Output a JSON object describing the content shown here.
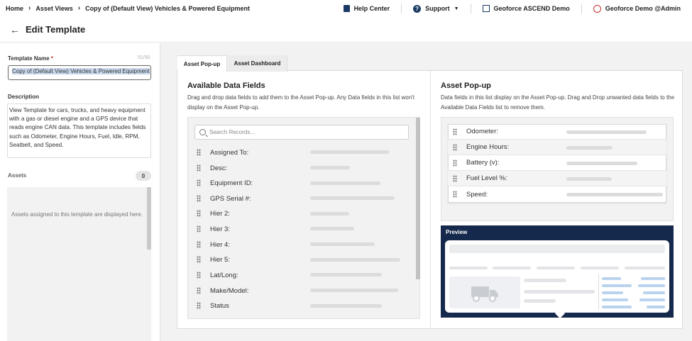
{
  "breadcrumb": [
    "Home",
    "Asset Views",
    "Copy of (Default View) Vehicles & Powered Equipment"
  ],
  "topnav": {
    "help": "Help Center",
    "support": "Support",
    "org": "Geoforce ASCEND Demo",
    "user": "Geoforce Demo @Admin"
  },
  "page": {
    "title": "Edit Template"
  },
  "form": {
    "name_label": "Template Name",
    "required_mark": "*",
    "name_counter": "51/90",
    "name_value": "Copy of (Default View) Vehicles & Powered Equipment",
    "description_label": "Description",
    "description_value": "View Template for cars, trucks, and heavy equipment with a gas or diesel engine and a GPS device that reads engine CAN data. This template includes fields such as Odometer, Engine Hours, Fuel, Idle, RPM, Seatbelt, and Speed.",
    "assets_label": "Assets",
    "assets_count": "0",
    "assets_empty": "Assets assigned to this template are displayed here."
  },
  "tabs": [
    "Asset Pop-up",
    "Asset Dashboard"
  ],
  "available": {
    "title": "Available Data Fields",
    "description": "Drag and drop data fields to add them to the Asset Pop-up. Any Data fields in this list won't display on the Asset Pop-up.",
    "search_placeholder": "Search Records...",
    "fields": [
      "Assigned To:",
      "Desc:",
      "Equipment ID:",
      "GPS Serial #:",
      "Hier 2:",
      "Hier 3:",
      "Hier 4:",
      "Hier 5:",
      "Lat/Long:",
      "Make/Model:",
      "Status"
    ]
  },
  "popup": {
    "title": "Asset Pop-up",
    "description": "Data fields in this list display on the Asset Pop-up. Drag and Drop unwanted data fields to the Available Data Fields list to remove them.",
    "fields": [
      "Odometer:",
      "Engine Hours:",
      "Battery (v):",
      "Fuel Level %:",
      "Speed:"
    ],
    "preview_label": "Preview"
  },
  "colors": {
    "navy": "#14294b",
    "required": "#c0302b",
    "preview_blue": "#b9d2ee"
  }
}
